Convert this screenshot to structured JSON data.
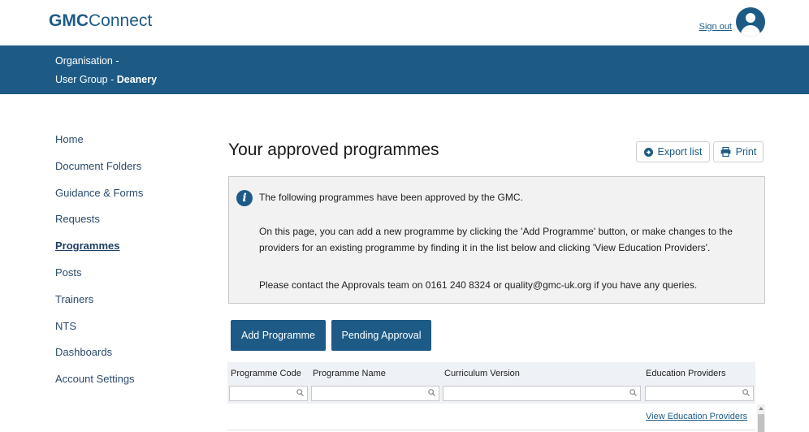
{
  "header": {
    "logo_bold": "GMC",
    "logo_rest": "Connect",
    "signout_label": "Sign out"
  },
  "org": {
    "org_label": "Organisation -",
    "group_prefix": "User Group - ",
    "group_name": "Deanery"
  },
  "sidebar": {
    "items": [
      {
        "label": "Home"
      },
      {
        "label": "Document Folders"
      },
      {
        "label": "Guidance & Forms"
      },
      {
        "label": "Requests"
      },
      {
        "label": "Programmes",
        "active": true
      },
      {
        "label": "Posts"
      },
      {
        "label": "Trainers"
      },
      {
        "label": "NTS"
      },
      {
        "label": "Dashboards"
      },
      {
        "label": "Account Settings"
      }
    ]
  },
  "main": {
    "title": "Your approved programmes",
    "export_label": "Export list",
    "print_label": "Print",
    "info": {
      "line1": "The following programmes have been approved by the GMC.",
      "line2": "On this page, you can add a new programme by clicking the 'Add Programme' button, or make changes to the providers for an existing programme by finding it in the list below and clicking 'View Education Providers'.",
      "line3": "Please contact the Approvals team on 0161 240 8324 or quality@gmc-uk.org if you have any queries."
    },
    "add_programme_label": "Add Programme",
    "pending_approval_label": "Pending Approval"
  },
  "table": {
    "columns": [
      "Programme Code",
      "Programme Name",
      "Curriculum Version",
      "Education Providers"
    ],
    "rows": [
      {
        "link": "View Education Providers"
      }
    ]
  },
  "colors": {
    "brand": "#1d5b86"
  }
}
